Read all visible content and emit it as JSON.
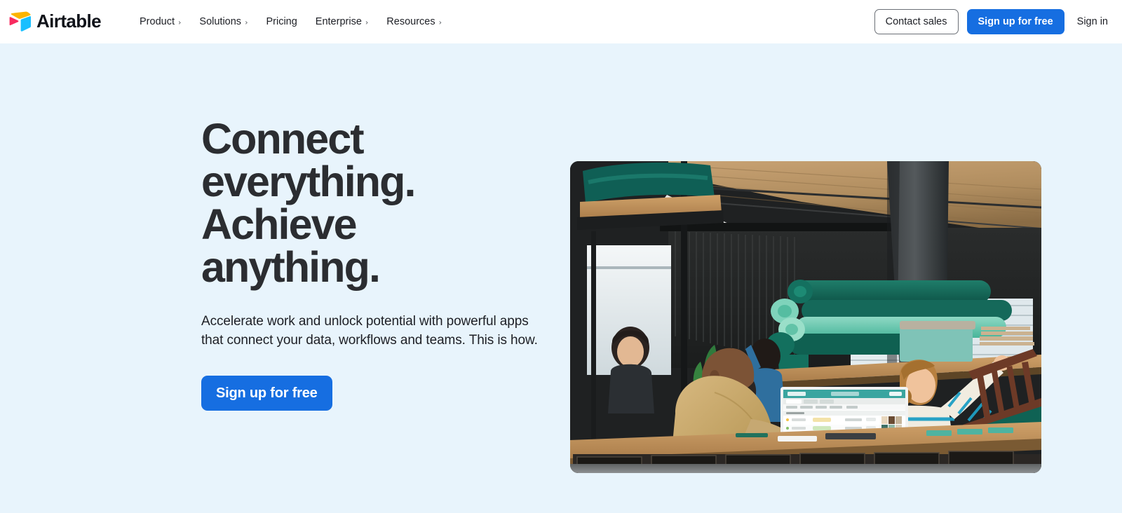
{
  "header": {
    "brand": {
      "name": "Airtable",
      "logo_icon": "airtable-cube-logo",
      "colors": {
        "yellow": "#fcb400",
        "blue": "#18bfff",
        "red": "#f82b60"
      }
    },
    "nav": [
      {
        "label": "Product",
        "has_submenu": true,
        "chevron": "›"
      },
      {
        "label": "Solutions",
        "has_submenu": true,
        "chevron": "›"
      },
      {
        "label": "Pricing",
        "has_submenu": false,
        "chevron": ""
      },
      {
        "label": "Enterprise",
        "has_submenu": true,
        "chevron": "›"
      },
      {
        "label": "Resources",
        "has_submenu": true,
        "chevron": "›"
      }
    ],
    "contact_sales_label": "Contact sales",
    "signup_label": "Sign up for free",
    "signin_label": "Sign in"
  },
  "hero": {
    "title_lines": [
      "Connect",
      "everything.",
      "Achieve",
      "anything."
    ],
    "subtitle": "Accelerate work and unlock potential with powerful apps that connect your data, workflows and teams. This is how.",
    "cta_label": "Sign up for free",
    "background_color": "#e8f4fc",
    "accent_color": "#166ee1",
    "image": {
      "alt": "Team collaborating in an industrial furniture workshop with a monitor showing an Airtable grid",
      "corner_radius_px": 12
    }
  }
}
